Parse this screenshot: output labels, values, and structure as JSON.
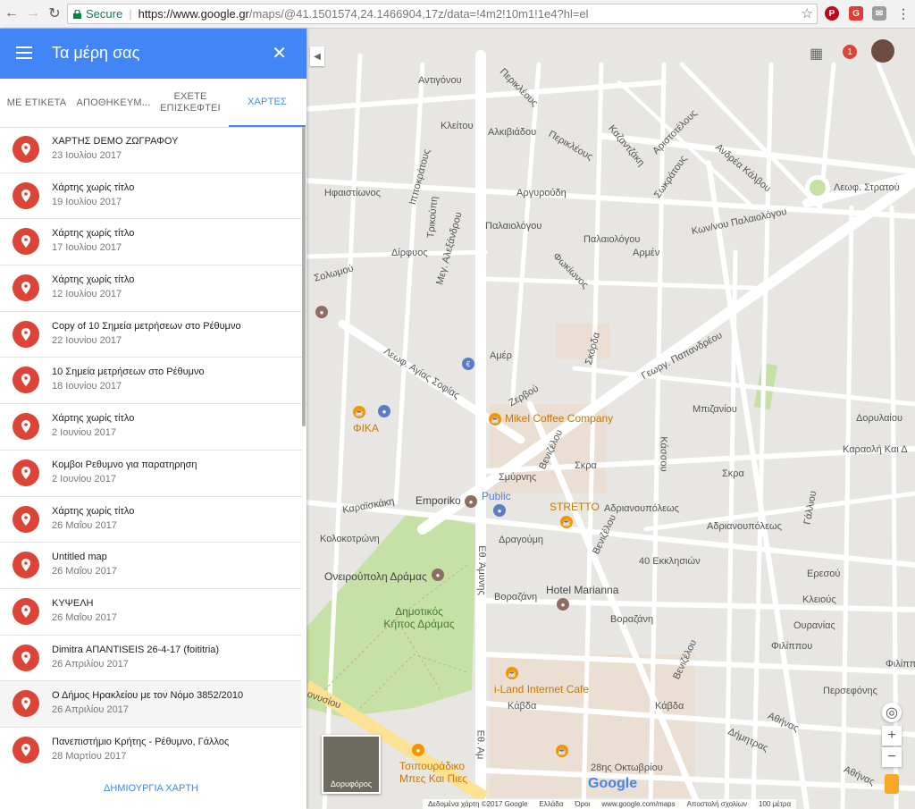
{
  "browser": {
    "secure_label": "Secure",
    "url_host": "https://www.google.gr",
    "url_rest": "/maps/@41.1501574,24.1466904,17z/data=!4m2!10m1!1e4?hl=el"
  },
  "panel": {
    "title": "Τα μέρη σας",
    "tabs": [
      "ΜΕ ΕΤΙΚΕΤΑ",
      "ΑΠΟΘΗΚΕΥΜ...",
      "ΕΧΕΤΕ ΕΠΙΣΚΕΦΤΕΙ",
      "ΧΑΡΤΕΣ"
    ],
    "items": [
      {
        "title": "ΧΑΡΤΗΣ DEMO ΖΩΓΡΑΦΟΥ",
        "date": "23 Ιουλίου 2017"
      },
      {
        "title": "Χάρτης χωρίς τίτλο",
        "date": "19 Ιουλίου 2017"
      },
      {
        "title": "Χάρτης χωρίς τίτλο",
        "date": "17 Ιουλίου 2017"
      },
      {
        "title": "Χάρτης χωρίς τίτλο",
        "date": "12 Ιουλίου 2017"
      },
      {
        "title": "Copy of 10 Σημεία μετρήσεων στο Ρέθυμνο",
        "date": "22 Ιουνίου 2017"
      },
      {
        "title": "10 Σημεία μετρήσεων στο Ρέθυμνο",
        "date": "18 Ιουνίου 2017"
      },
      {
        "title": "Χάρτης χωρίς τίτλο",
        "date": "2 Ιουνίου 2017"
      },
      {
        "title": "Κομβοι Ρεθυμνο για παρατηρηση",
        "date": "2 Ιουνίου 2017"
      },
      {
        "title": "Χάρτης χωρίς τίτλο",
        "date": "26 Μαΐου 2017"
      },
      {
        "title": "Untitled map",
        "date": "26 Μαΐου 2017"
      },
      {
        "title": "ΚΥΨΕΛΗ",
        "date": "26 Μαΐου 2017"
      },
      {
        "title": "Dimitra ΑΠΑΝΤΙSEIS 26-4-17 (foititria)",
        "date": "26 Απριλίου 2017"
      },
      {
        "title": "Ο Δήμος Ηρακλείου με τον Νόμο 3852/2010",
        "date": "26 Απριλίου 2017"
      },
      {
        "title": "Πανεπιστήμιο Κρήτης - Ρέθυμνο, Γάλλος",
        "date": "28 Μαρτίου 2017"
      }
    ],
    "create_label": "ΔΗΜΙΟΥΡΓΙΑ ΧΑΡΤΗ"
  },
  "map": {
    "notification_count": "1",
    "satellite_label": "Δορυφόρος",
    "google_logo": "Google",
    "streets": {
      "antigonou": "Αντιγόνου",
      "perikleous1": "Περικλέους",
      "kleitou": "Κλείτου",
      "alkiviadou": "Αλκιβιάδου",
      "perikleous2": "Περικλέους",
      "kazantzaki": "Καζαντζάκη",
      "sokratous": "Σωκράτους",
      "andrea_kalvou": "Ανδρέα Κάλβου",
      "aristotelous": "Αριστοτέλους",
      "ifaistionos": "Ηφαιστίωνος",
      "trikoupi": "Τρικούπη",
      "argyroudi": "Αργυρούδη",
      "palaiologou": "Παλαιολόγου",
      "palaiologou2": "Παλαιολόγου",
      "leof_stratou": "Λεωφ. Στρατού",
      "kon_palaiologou": "Κων/νου Παλαιολόγου",
      "dirfyos": "Δίρφυος",
      "solomou": "Σολωμού",
      "armen": "Αρμέν",
      "meg_alexandrou": "Μεγ. Αλεξάνδρου",
      "leof_ag_sofias": "Λεωφ. Αγίας Σοφίας",
      "amer": "Αμέρ",
      "zervou": "Ζερβού",
      "papandreou": "Γεωργ. Παπανδρέου",
      "mpitzaniou": "Μπιζανίου",
      "dorylaiou": "Δορυλαίου",
      "karaoli": "Καραολή Και Δ",
      "skra": "Σκρα",
      "skra2": "Σκρα",
      "karaiskaki": "Καραϊσκάκη",
      "kolokotroni": "Κολοκοτρώνη",
      "smyrnis": "Σμύρνης",
      "adrianoupoleos": "Αδριανουπόλεως",
      "adrianoupoleos2": "Αδριανουπόλεως",
      "dragoumi": "Δραγούμη",
      "ekklision": "40 Εκκλησιών",
      "eresou": "Ερεσού",
      "kleious": "Κλειούς",
      "ouranias": "Ουρανίας",
      "vorazani": "Βοραζάνη",
      "vorazani2": "Βοραζάνη",
      "filippou": "Φιλίππου",
      "filippou2": "Φιλίππ",
      "perisefonis": "Περσεφόνης",
      "kavda": "Κάβδα",
      "kavda2": "Κάβδα",
      "oktovriou": "28ης Οκτωβρίου",
      "dimitras": "Δήμητρας",
      "athinas": "Αθήνας",
      "athinas2": "Αθήνας",
      "ethn_aminis": "Εθ. Άμυνης",
      "ethn_aminis2": "Εθ. Αμ",
      "venizelou": "Βενιζέλου",
      "venizelou2": "Βενιζέλου",
      "venizelou3": "Βενιζέλου",
      "galliou": "Γάλλιου",
      "onoysou": "ονυσίου",
      "ippokratous": "Ιπποκράτους",
      "kassou": "Κάσσου",
      "xenou": "Σκόρδα",
      "fokionos": "Φωκίωνος"
    },
    "pois": {
      "mikel": "Mikel Coffee Company",
      "fika": "ΦΙΚΑ",
      "emporiko": "Emporiko",
      "public": "Public",
      "stretto": "STRETTO",
      "oneiroupoli": "Ονειρούπολη Δράμας",
      "park": "Δημοτικός Κήπος Δράμας",
      "hotel": "Hotel Marianna",
      "iland": "i-Land Internet Cafe",
      "tsipouradiko": "Τσιπουράδικο Μπες Και Πιες"
    },
    "footer": [
      "Δεδομένα χάρτη ©2017 Google",
      "Ελλάδα",
      "Όροι",
      "www.google.com/maps",
      "Αποστολή σχολίων",
      "100 μέτρα"
    ]
  },
  "colors": {
    "accent": "#4285f4",
    "pin": "#db4437",
    "park": "#c5e1a5",
    "road": "#ffffff",
    "map_bg": "#e5e3df"
  }
}
